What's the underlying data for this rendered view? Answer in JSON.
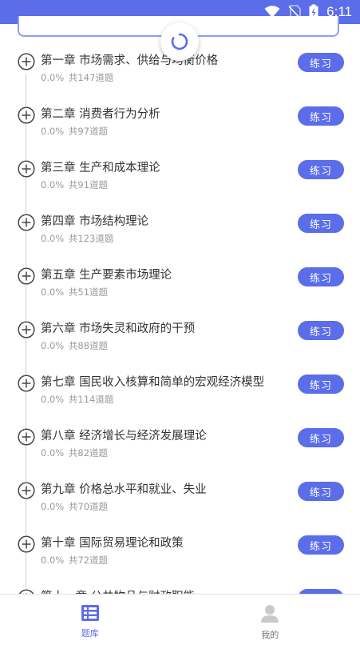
{
  "status_bar": {
    "time": "6:11"
  },
  "chapters": [
    {
      "title": "第一章 市场需求、供给与均衡价格",
      "progress": "0.0%",
      "count": "共147道题",
      "action": "练习"
    },
    {
      "title": "第二章 消费者行为分析",
      "progress": "0.0%",
      "count": "共97道题",
      "action": "练习"
    },
    {
      "title": "第三章 生产和成本理论",
      "progress": "0.0%",
      "count": "共91道题",
      "action": "练习"
    },
    {
      "title": "第四章 市场结构理论",
      "progress": "0.0%",
      "count": "共123道题",
      "action": "练习"
    },
    {
      "title": "第五章 生产要素市场理论",
      "progress": "0.0%",
      "count": "共51道题",
      "action": "练习"
    },
    {
      "title": "第六章 市场失灵和政府的干预",
      "progress": "0.0%",
      "count": "共88道题",
      "action": "练习"
    },
    {
      "title": "第七章 国民收入核算和简单的宏观经济模型",
      "progress": "0.0%",
      "count": "共114道题",
      "action": "练习"
    },
    {
      "title": "第八章 经济增长与经济发展理论",
      "progress": "0.0%",
      "count": "共82道题",
      "action": "练习"
    },
    {
      "title": "第九章 价格总水平和就业、失业",
      "progress": "0.0%",
      "count": "共70道题",
      "action": "练习"
    },
    {
      "title": "第十章 国际贸易理论和政策",
      "progress": "0.0%",
      "count": "共72道题",
      "action": "练习"
    },
    {
      "title": "第十一章 公共物品与财政职能",
      "progress": "",
      "count": "",
      "action": "练习"
    }
  ],
  "bottom_nav": [
    {
      "label": "题库",
      "icon": "question-bank-icon",
      "active": true
    },
    {
      "label": "我的",
      "icon": "profile-icon",
      "active": false
    }
  ],
  "colors": {
    "accent": "#5b6de8",
    "card_border": "#8f9df0"
  }
}
